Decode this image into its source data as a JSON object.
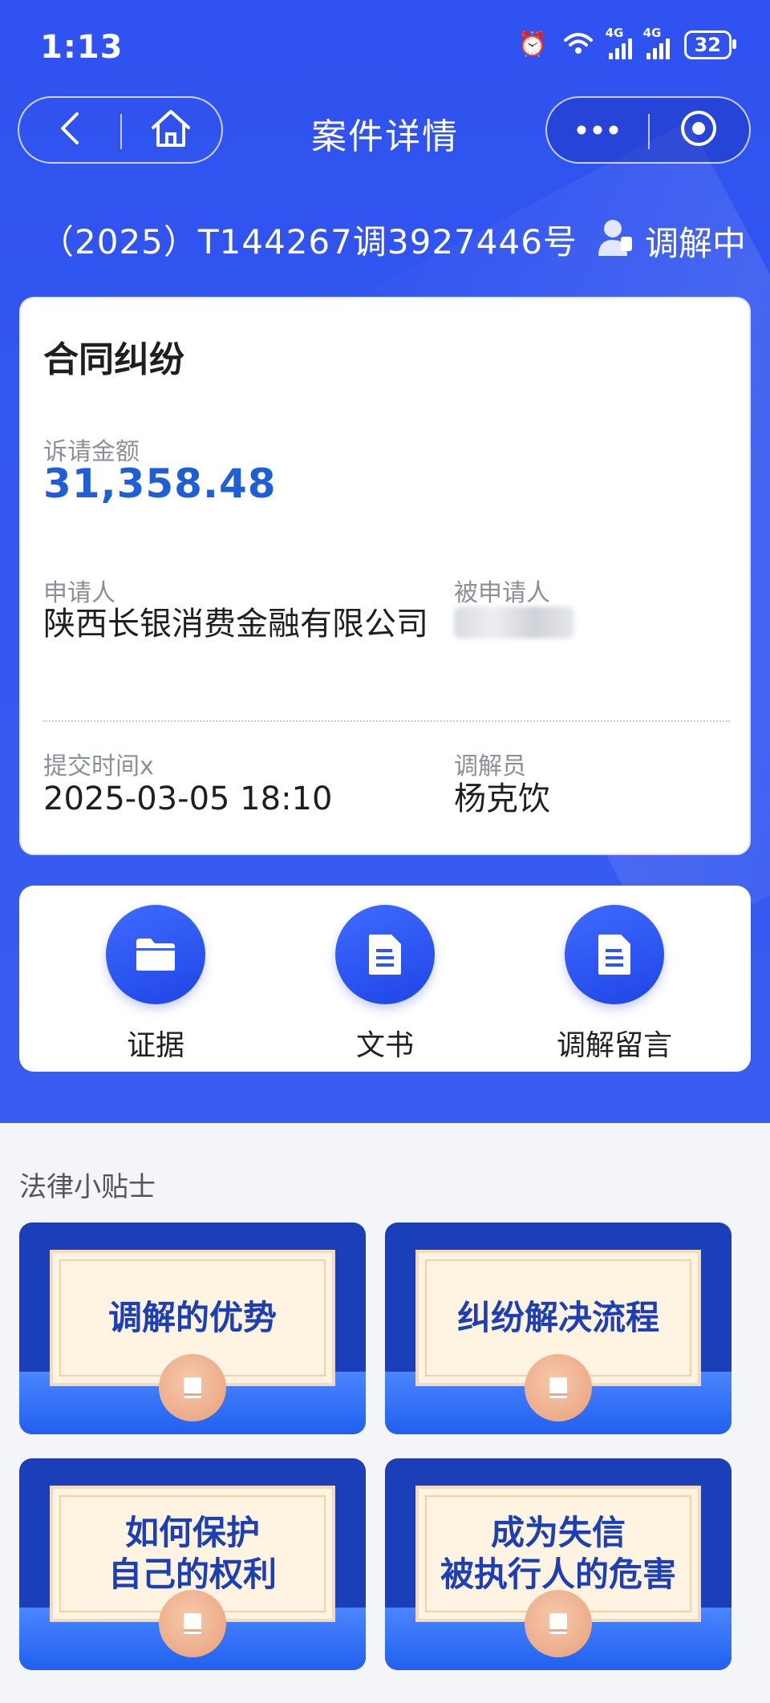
{
  "status_bar": {
    "time": "1:13",
    "network_1": "4G",
    "network_2": "4G",
    "battery": "32"
  },
  "nav": {
    "title": "案件详情"
  },
  "case": {
    "number": "（2025）T144267调3927446号",
    "status": "调解中"
  },
  "info": {
    "category": "合同纠纷",
    "amount_label": "诉请金额",
    "amount": "31,358.48",
    "applicant_label": "申请人",
    "applicant": "陕西长银消费金融有限公司",
    "respondent_label": "被申请人",
    "submit_time_label": "提交时间x",
    "submit_time": "2025-03-05 18:10",
    "mediator_label": "调解员",
    "mediator": "杨克饮"
  },
  "actions": [
    {
      "label": "证据",
      "icon": "folder-icon"
    },
    {
      "label": "文书",
      "icon": "document-icon"
    },
    {
      "label": "调解留言",
      "icon": "document-icon"
    }
  ],
  "tips": {
    "title": "法律小贴士",
    "items": [
      {
        "text": "调解的优势"
      },
      {
        "text": "纠纷解决流程"
      },
      {
        "text": "如何保护\n自己的权利"
      },
      {
        "text": "成为失信\n被执行人的危害"
      }
    ]
  },
  "colors": {
    "primary": "#3357f0",
    "amount": "#1e5fd6",
    "tip_text": "#1d3fb6"
  }
}
